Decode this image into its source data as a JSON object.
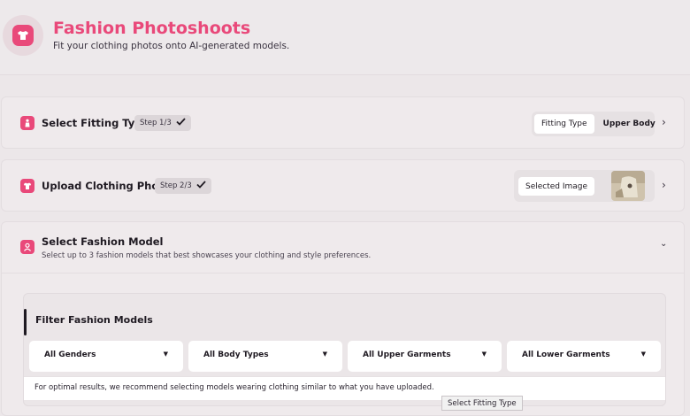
{
  "header": {
    "title": "Fashion Photoshoots",
    "subtitle": "Fit your clothing photos onto AI-generated models.",
    "brand_color": "#e9497a",
    "icon": "shirt-icon"
  },
  "steps": [
    {
      "title": "Select Fitting Type",
      "badge": "Step 1/3",
      "completed": true,
      "icon": "figure-icon",
      "summary_label": "Fitting Type",
      "summary_value": "Upper Body"
    },
    {
      "title": "Upload Clothing Photo",
      "badge": "Step 2/3",
      "completed": true,
      "icon": "tshirt-icon",
      "summary_label": "Selected Image"
    },
    {
      "title": "Select Fashion Model",
      "description": "Select up to 3 fashion models that best showcases your clothing and style preferences.",
      "icon": "model-icon",
      "expanded": true
    }
  ],
  "filters": {
    "title": "Filter Fashion Models",
    "dropdowns": [
      "All Genders",
      "All Body Types",
      "All Upper Garments",
      "All Lower Garments"
    ],
    "notice": "For optimal results, we recommend selecting models wearing clothing similar to what you have uploaded."
  },
  "tooltip": "Select Fitting Type"
}
